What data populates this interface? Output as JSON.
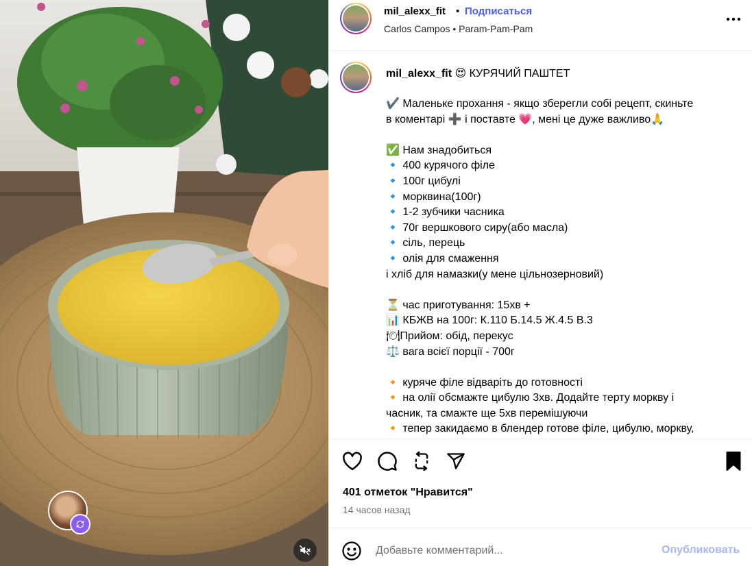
{
  "post": {
    "author": "mil_alexx_fit",
    "follow_label": "Подписаться",
    "header_dot": "•",
    "sub_line": "Carlos Campos • Param-Pam-Pam",
    "media_icons": {
      "remix": "remix-icon",
      "mute": "speaker-muted-icon"
    }
  },
  "caption": {
    "author": "mil_alexx_fit",
    "head_emoji": "😍",
    "title": "КУРЯЧИЙ ПАШТЕТ",
    "lines": [
      "✔️ Маленьке прохання - якщо зберегли собі рецепт, скиньте",
      "в коментарі ➕ і поставте 💗, мені це дуже важливо🙏",
      "",
      "✅ Нам знадобиться",
      "🔹 400 курячого філе",
      "🔹 100г цибулі",
      "🔹 морквина(100г)",
      "🔹 1-2 зубчики часника",
      "🔹 70г вершкового сиру(або масла)",
      "🔹 сіль, перець",
      "🔹 олія для смаження",
      "і хліб для намазки(у мене цільнозерновий)",
      "",
      "⏳ час приготування: 15хв +",
      "📊 КБЖВ на 100г: К.110 Б.14.5 Ж.4.5 В.3",
      "🍽Прийом: обід, перекус",
      "⚖️ вага всієї порції - 700г",
      "",
      "🔸 куряче філе відваріть до готовності",
      "🔸 на олії обсмажте цибулю 3хв. Додайте терту моркву і",
      "часник, та смажте ще 5хв перемішуючи",
      "🔸 тепер закидаємо в блендер готове філе, цибулю, моркву,"
    ]
  },
  "actions": {
    "icons": [
      "heart-icon",
      "comment-icon",
      "repost-icon",
      "share-icon",
      "bookmark-icon"
    ],
    "likes": "401 отметок \"Нравится\"",
    "time": "14 часов назад"
  },
  "comment": {
    "placeholder": "Добавьте комментарий...",
    "post_label": "Опубликовать"
  },
  "colors": {
    "accent": "#4a5df9",
    "post_disabled": "#a8b5fb",
    "muted_text": "#737373",
    "divider": "#efefef"
  }
}
